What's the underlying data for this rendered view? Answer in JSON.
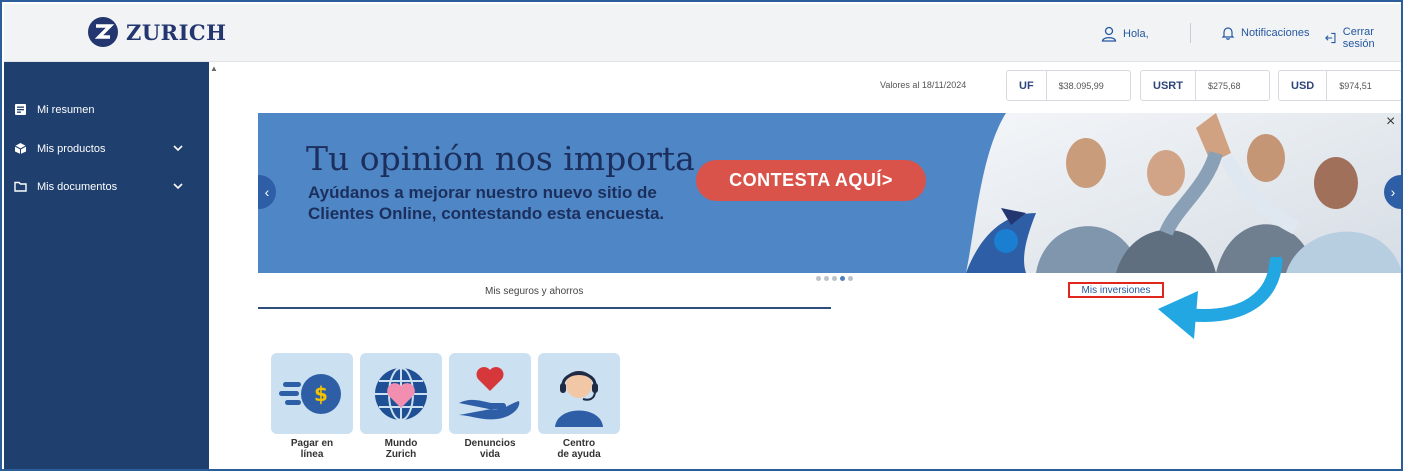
{
  "header": {
    "brand": "ZURICH",
    "greeting": "Hola,",
    "notifications": "Notificaciones",
    "logout": "Cerrar sesión"
  },
  "sidebar": {
    "items": [
      {
        "label": "Mi resumen",
        "icon": "summary-icon",
        "expandable": false
      },
      {
        "label": "Mis productos",
        "icon": "products-icon",
        "expandable": true
      },
      {
        "label": "Mis documentos",
        "icon": "folder-icon",
        "expandable": true
      }
    ]
  },
  "fx": {
    "date_label": "Valores al 18/11/2024",
    "rates": [
      {
        "code": "UF",
        "value": "$38.095,99"
      },
      {
        "code": "USRT",
        "value": "$275,68"
      },
      {
        "code": "USD",
        "value": "$974,51"
      }
    ]
  },
  "banner": {
    "title": "Tu opinión nos importa",
    "text": "Ayúdanos a mejorar nuestro nuevo sitio de Clientes Online, contestando esta encuesta.",
    "cta": "CONTESTA AQUÍ>",
    "close": "×",
    "prev": "‹",
    "next": "›",
    "slides": 5,
    "active_slide": 4
  },
  "tabs": {
    "seguros": "Mis seguros y ahorros",
    "inversiones": "Mis inversiones"
  },
  "tiles": [
    {
      "line1": "Pagar en",
      "line2": "línea",
      "icon": "payment-icon"
    },
    {
      "line1": "Mundo",
      "line2": "Zurich",
      "icon": "globe-heart-icon"
    },
    {
      "line1": "Denuncios",
      "line2": "vida",
      "icon": "hand-heart-icon"
    },
    {
      "line1": "Centro",
      "line2": "de ayuda",
      "icon": "support-agent-icon"
    }
  ],
  "colors": {
    "brand_navy": "#23366f",
    "sidebar": "#1f3f6e",
    "banner": "#4e86c6",
    "cta": "#d9534a",
    "highlight": "#e0271d",
    "arrow": "#22a7e3"
  }
}
